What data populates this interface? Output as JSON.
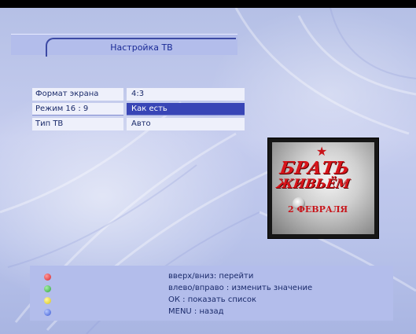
{
  "title": "Настройка ТВ",
  "menu": [
    {
      "label": "Формат экрана",
      "value": "4:3"
    },
    {
      "label": "Режим 16 : 9",
      "value": "Как есть"
    },
    {
      "label": "Тип ТВ",
      "value": "Авто"
    }
  ],
  "selected_row": 1,
  "preview": {
    "line1": "БРАТЬ",
    "line2": "ЖИВЬЁМ",
    "line3": "2 ФЕВРАЛЯ"
  },
  "help": {
    "red": "вверх/вниз: перейти",
    "green": "влево/вправо : изменить значение",
    "yellow": "ОК : показать список",
    "blue": "MENU : назад"
  },
  "colors": {
    "selection": "#3845b6",
    "panel": "#b3bdeb",
    "text": "#1a2a6a",
    "accent_red": "#d8141a"
  }
}
